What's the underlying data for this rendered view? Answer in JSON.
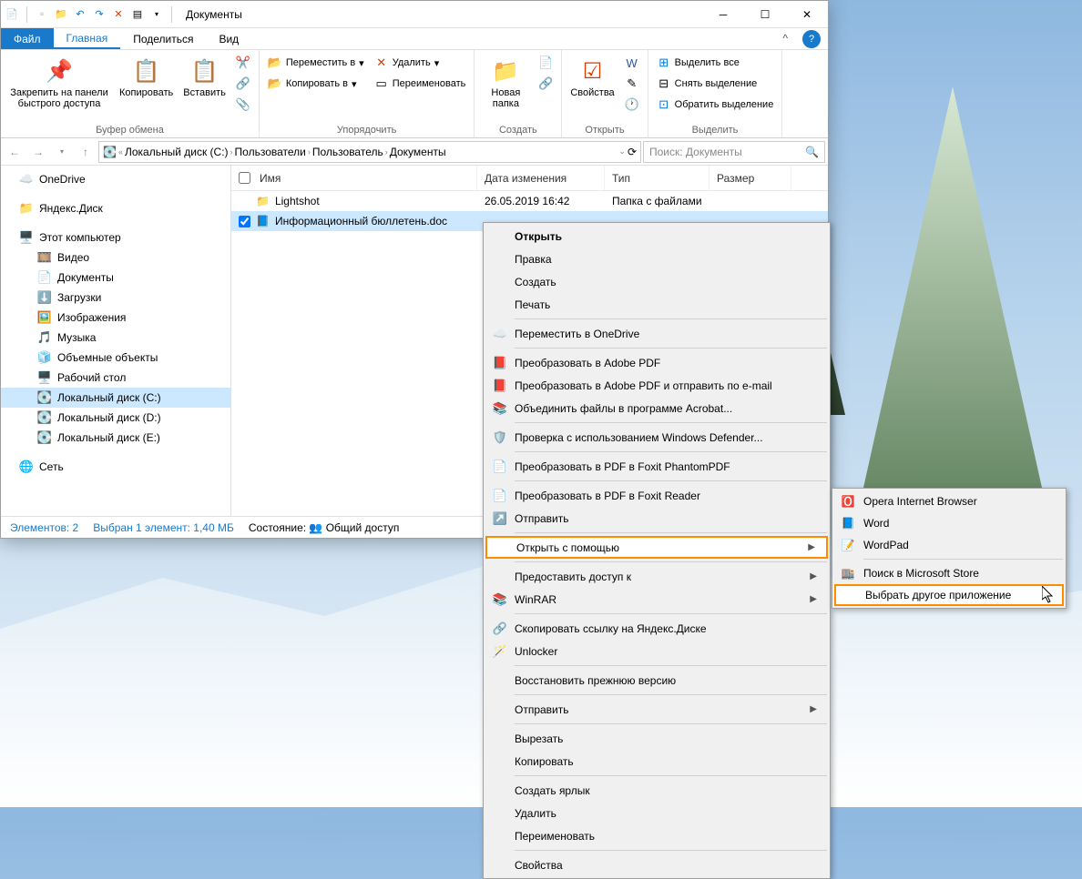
{
  "window": {
    "title": "Документы"
  },
  "menu": {
    "file": "Файл",
    "tabs": [
      "Главная",
      "Поделиться",
      "Вид"
    ]
  },
  "ribbon": {
    "clipboard": {
      "pin": "Закрепить на панели быстрого доступа",
      "copy": "Копировать",
      "paste": "Вставить",
      "label": "Буфер обмена"
    },
    "organize": {
      "move": "Переместить в",
      "copyto": "Копировать в",
      "delete": "Удалить",
      "rename": "Переименовать",
      "label": "Упорядочить"
    },
    "new": {
      "folder": "Новая папка",
      "label": "Создать"
    },
    "open": {
      "props": "Свойства",
      "label": "Открыть"
    },
    "select": {
      "all": "Выделить все",
      "none": "Снять выделение",
      "invert": "Обратить выделение",
      "label": "Выделить"
    }
  },
  "breadcrumb": {
    "parts": [
      "Локальный диск (C:)",
      "Пользователи",
      "Пользователь",
      "Документы"
    ]
  },
  "search": {
    "placeholder": "Поиск: Документы"
  },
  "sidebar": {
    "items": [
      {
        "label": "OneDrive",
        "ico": "☁️",
        "indent": false
      },
      {
        "label": "Яндекс.Диск",
        "ico": "📁",
        "indent": false
      },
      {
        "label": "Этот компьютер",
        "ico": "🖥️",
        "indent": false
      },
      {
        "label": "Видео",
        "ico": "🎞️",
        "indent": true
      },
      {
        "label": "Документы",
        "ico": "📄",
        "indent": true
      },
      {
        "label": "Загрузки",
        "ico": "⬇️",
        "indent": true
      },
      {
        "label": "Изображения",
        "ico": "🖼️",
        "indent": true
      },
      {
        "label": "Музыка",
        "ico": "🎵",
        "indent": true
      },
      {
        "label": "Объемные объекты",
        "ico": "🧊",
        "indent": true
      },
      {
        "label": "Рабочий стол",
        "ico": "🖥️",
        "indent": true
      },
      {
        "label": "Локальный диск (C:)",
        "ico": "💽",
        "indent": true,
        "selected": true
      },
      {
        "label": "Локальный диск (D:)",
        "ico": "💽",
        "indent": true
      },
      {
        "label": "Локальный диск (E:)",
        "ico": "💽",
        "indent": true
      },
      {
        "label": "Сеть",
        "ico": "🌐",
        "indent": false
      }
    ]
  },
  "columns": {
    "name": "Имя",
    "date": "Дата изменения",
    "type": "Тип",
    "size": "Размер"
  },
  "files": [
    {
      "ico": "📁",
      "name": "Lightshot",
      "date": "26.05.2019 16:42",
      "type": "Папка с файлами",
      "selected": false
    },
    {
      "ico": "📘",
      "name": "Информационный бюллетень.doc",
      "date": "",
      "type": "",
      "selected": true
    }
  ],
  "status": {
    "count": "Элементов: 2",
    "selected": "Выбран 1 элемент: 1,40 МБ",
    "state_label": "Состояние:",
    "shared": "Общий доступ"
  },
  "context": {
    "items": [
      {
        "label": "Открыть",
        "bold": true
      },
      {
        "label": "Правка"
      },
      {
        "label": "Создать"
      },
      {
        "label": "Печать"
      },
      {
        "sep": true
      },
      {
        "label": "Переместить в OneDrive",
        "ico": "☁️"
      },
      {
        "sep": true
      },
      {
        "label": "Преобразовать в Adobe PDF",
        "ico": "📕"
      },
      {
        "label": "Преобразовать в Adobe PDF и отправить по e-mail",
        "ico": "📕"
      },
      {
        "label": "Объединить файлы в программе Acrobat...",
        "ico": "📚"
      },
      {
        "sep": true
      },
      {
        "label": "Проверка с использованием Windows Defender...",
        "ico": "🛡️"
      },
      {
        "sep": true
      },
      {
        "label": "Преобразовать в PDF в Foxit PhantomPDF",
        "ico": "📄"
      },
      {
        "sep": true
      },
      {
        "label": "Преобразовать в PDF в Foxit Reader",
        "ico": "📄"
      },
      {
        "label": "Отправить",
        "ico": "↗️"
      },
      {
        "sep": true
      },
      {
        "label": "Открыть с помощью",
        "arrow": true,
        "highlight": true
      },
      {
        "sep": true
      },
      {
        "label": "Предоставить доступ к",
        "arrow": true
      },
      {
        "label": "WinRAR",
        "ico": "📚",
        "arrow": true
      },
      {
        "sep": true
      },
      {
        "label": "Скопировать ссылку на Яндекс.Диске",
        "ico": "🔗"
      },
      {
        "label": "Unlocker",
        "ico": "🪄"
      },
      {
        "sep": true
      },
      {
        "label": "Восстановить прежнюю версию"
      },
      {
        "sep": true
      },
      {
        "label": "Отправить",
        "arrow": true
      },
      {
        "sep": true
      },
      {
        "label": "Вырезать"
      },
      {
        "label": "Копировать"
      },
      {
        "sep": true
      },
      {
        "label": "Создать ярлык"
      },
      {
        "label": "Удалить"
      },
      {
        "label": "Переименовать"
      },
      {
        "sep": true
      },
      {
        "label": "Свойства"
      }
    ]
  },
  "submenu": {
    "items": [
      {
        "label": "Opera Internet Browser",
        "ico": "🅾️"
      },
      {
        "label": "Word",
        "ico": "📘"
      },
      {
        "label": "WordPad",
        "ico": "📝"
      },
      {
        "sep": true
      },
      {
        "label": "Поиск в Microsoft Store",
        "ico": "🏬"
      },
      {
        "label": "Выбрать другое приложение",
        "highlight": true
      }
    ]
  }
}
